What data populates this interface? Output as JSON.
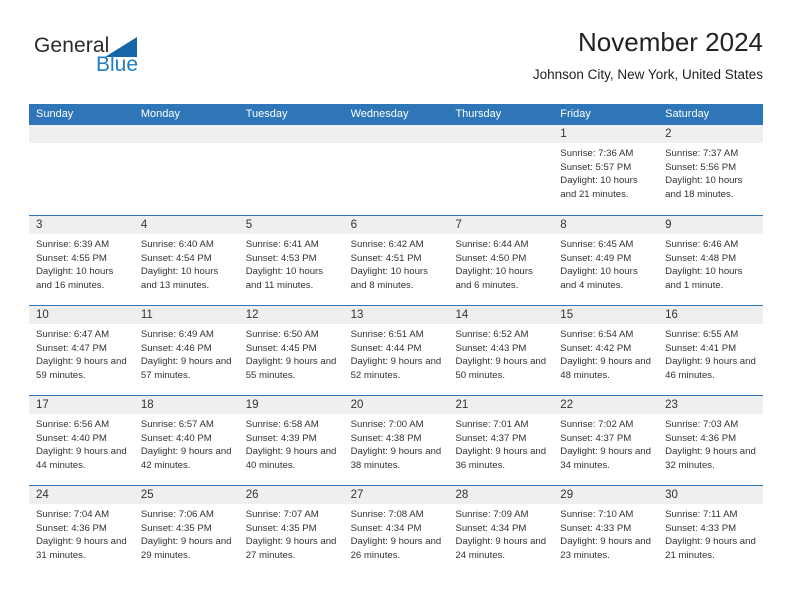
{
  "brand": {
    "name_part1": "General",
    "name_part2": "Blue",
    "accent_color": "#1f7ec4",
    "header_color": "#2e76b8"
  },
  "header": {
    "title": "November 2024",
    "subtitle": "Johnson City, New York, United States"
  },
  "calendar": {
    "weekdays": [
      "Sunday",
      "Monday",
      "Tuesday",
      "Wednesday",
      "Thursday",
      "Friday",
      "Saturday"
    ],
    "weeks": [
      [
        {
          "day": "",
          "sunrise": "",
          "sunset": "",
          "daylight": ""
        },
        {
          "day": "",
          "sunrise": "",
          "sunset": "",
          "daylight": ""
        },
        {
          "day": "",
          "sunrise": "",
          "sunset": "",
          "daylight": ""
        },
        {
          "day": "",
          "sunrise": "",
          "sunset": "",
          "daylight": ""
        },
        {
          "day": "",
          "sunrise": "",
          "sunset": "",
          "daylight": ""
        },
        {
          "day": "1",
          "sunrise": "Sunrise: 7:36 AM",
          "sunset": "Sunset: 5:57 PM",
          "daylight": "Daylight: 10 hours and 21 minutes."
        },
        {
          "day": "2",
          "sunrise": "Sunrise: 7:37 AM",
          "sunset": "Sunset: 5:56 PM",
          "daylight": "Daylight: 10 hours and 18 minutes."
        }
      ],
      [
        {
          "day": "3",
          "sunrise": "Sunrise: 6:39 AM",
          "sunset": "Sunset: 4:55 PM",
          "daylight": "Daylight: 10 hours and 16 minutes."
        },
        {
          "day": "4",
          "sunrise": "Sunrise: 6:40 AM",
          "sunset": "Sunset: 4:54 PM",
          "daylight": "Daylight: 10 hours and 13 minutes."
        },
        {
          "day": "5",
          "sunrise": "Sunrise: 6:41 AM",
          "sunset": "Sunset: 4:53 PM",
          "daylight": "Daylight: 10 hours and 11 minutes."
        },
        {
          "day": "6",
          "sunrise": "Sunrise: 6:42 AM",
          "sunset": "Sunset: 4:51 PM",
          "daylight": "Daylight: 10 hours and 8 minutes."
        },
        {
          "day": "7",
          "sunrise": "Sunrise: 6:44 AM",
          "sunset": "Sunset: 4:50 PM",
          "daylight": "Daylight: 10 hours and 6 minutes."
        },
        {
          "day": "8",
          "sunrise": "Sunrise: 6:45 AM",
          "sunset": "Sunset: 4:49 PM",
          "daylight": "Daylight: 10 hours and 4 minutes."
        },
        {
          "day": "9",
          "sunrise": "Sunrise: 6:46 AM",
          "sunset": "Sunset: 4:48 PM",
          "daylight": "Daylight: 10 hours and 1 minute."
        }
      ],
      [
        {
          "day": "10",
          "sunrise": "Sunrise: 6:47 AM",
          "sunset": "Sunset: 4:47 PM",
          "daylight": "Daylight: 9 hours and 59 minutes."
        },
        {
          "day": "11",
          "sunrise": "Sunrise: 6:49 AM",
          "sunset": "Sunset: 4:46 PM",
          "daylight": "Daylight: 9 hours and 57 minutes."
        },
        {
          "day": "12",
          "sunrise": "Sunrise: 6:50 AM",
          "sunset": "Sunset: 4:45 PM",
          "daylight": "Daylight: 9 hours and 55 minutes."
        },
        {
          "day": "13",
          "sunrise": "Sunrise: 6:51 AM",
          "sunset": "Sunset: 4:44 PM",
          "daylight": "Daylight: 9 hours and 52 minutes."
        },
        {
          "day": "14",
          "sunrise": "Sunrise: 6:52 AM",
          "sunset": "Sunset: 4:43 PM",
          "daylight": "Daylight: 9 hours and 50 minutes."
        },
        {
          "day": "15",
          "sunrise": "Sunrise: 6:54 AM",
          "sunset": "Sunset: 4:42 PM",
          "daylight": "Daylight: 9 hours and 48 minutes."
        },
        {
          "day": "16",
          "sunrise": "Sunrise: 6:55 AM",
          "sunset": "Sunset: 4:41 PM",
          "daylight": "Daylight: 9 hours and 46 minutes."
        }
      ],
      [
        {
          "day": "17",
          "sunrise": "Sunrise: 6:56 AM",
          "sunset": "Sunset: 4:40 PM",
          "daylight": "Daylight: 9 hours and 44 minutes."
        },
        {
          "day": "18",
          "sunrise": "Sunrise: 6:57 AM",
          "sunset": "Sunset: 4:40 PM",
          "daylight": "Daylight: 9 hours and 42 minutes."
        },
        {
          "day": "19",
          "sunrise": "Sunrise: 6:58 AM",
          "sunset": "Sunset: 4:39 PM",
          "daylight": "Daylight: 9 hours and 40 minutes."
        },
        {
          "day": "20",
          "sunrise": "Sunrise: 7:00 AM",
          "sunset": "Sunset: 4:38 PM",
          "daylight": "Daylight: 9 hours and 38 minutes."
        },
        {
          "day": "21",
          "sunrise": "Sunrise: 7:01 AM",
          "sunset": "Sunset: 4:37 PM",
          "daylight": "Daylight: 9 hours and 36 minutes."
        },
        {
          "day": "22",
          "sunrise": "Sunrise: 7:02 AM",
          "sunset": "Sunset: 4:37 PM",
          "daylight": "Daylight: 9 hours and 34 minutes."
        },
        {
          "day": "23",
          "sunrise": "Sunrise: 7:03 AM",
          "sunset": "Sunset: 4:36 PM",
          "daylight": "Daylight: 9 hours and 32 minutes."
        }
      ],
      [
        {
          "day": "24",
          "sunrise": "Sunrise: 7:04 AM",
          "sunset": "Sunset: 4:36 PM",
          "daylight": "Daylight: 9 hours and 31 minutes."
        },
        {
          "day": "25",
          "sunrise": "Sunrise: 7:06 AM",
          "sunset": "Sunset: 4:35 PM",
          "daylight": "Daylight: 9 hours and 29 minutes."
        },
        {
          "day": "26",
          "sunrise": "Sunrise: 7:07 AM",
          "sunset": "Sunset: 4:35 PM",
          "daylight": "Daylight: 9 hours and 27 minutes."
        },
        {
          "day": "27",
          "sunrise": "Sunrise: 7:08 AM",
          "sunset": "Sunset: 4:34 PM",
          "daylight": "Daylight: 9 hours and 26 minutes."
        },
        {
          "day": "28",
          "sunrise": "Sunrise: 7:09 AM",
          "sunset": "Sunset: 4:34 PM",
          "daylight": "Daylight: 9 hours and 24 minutes."
        },
        {
          "day": "29",
          "sunrise": "Sunrise: 7:10 AM",
          "sunset": "Sunset: 4:33 PM",
          "daylight": "Daylight: 9 hours and 23 minutes."
        },
        {
          "day": "30",
          "sunrise": "Sunrise: 7:11 AM",
          "sunset": "Sunset: 4:33 PM",
          "daylight": "Daylight: 9 hours and 21 minutes."
        }
      ]
    ]
  }
}
